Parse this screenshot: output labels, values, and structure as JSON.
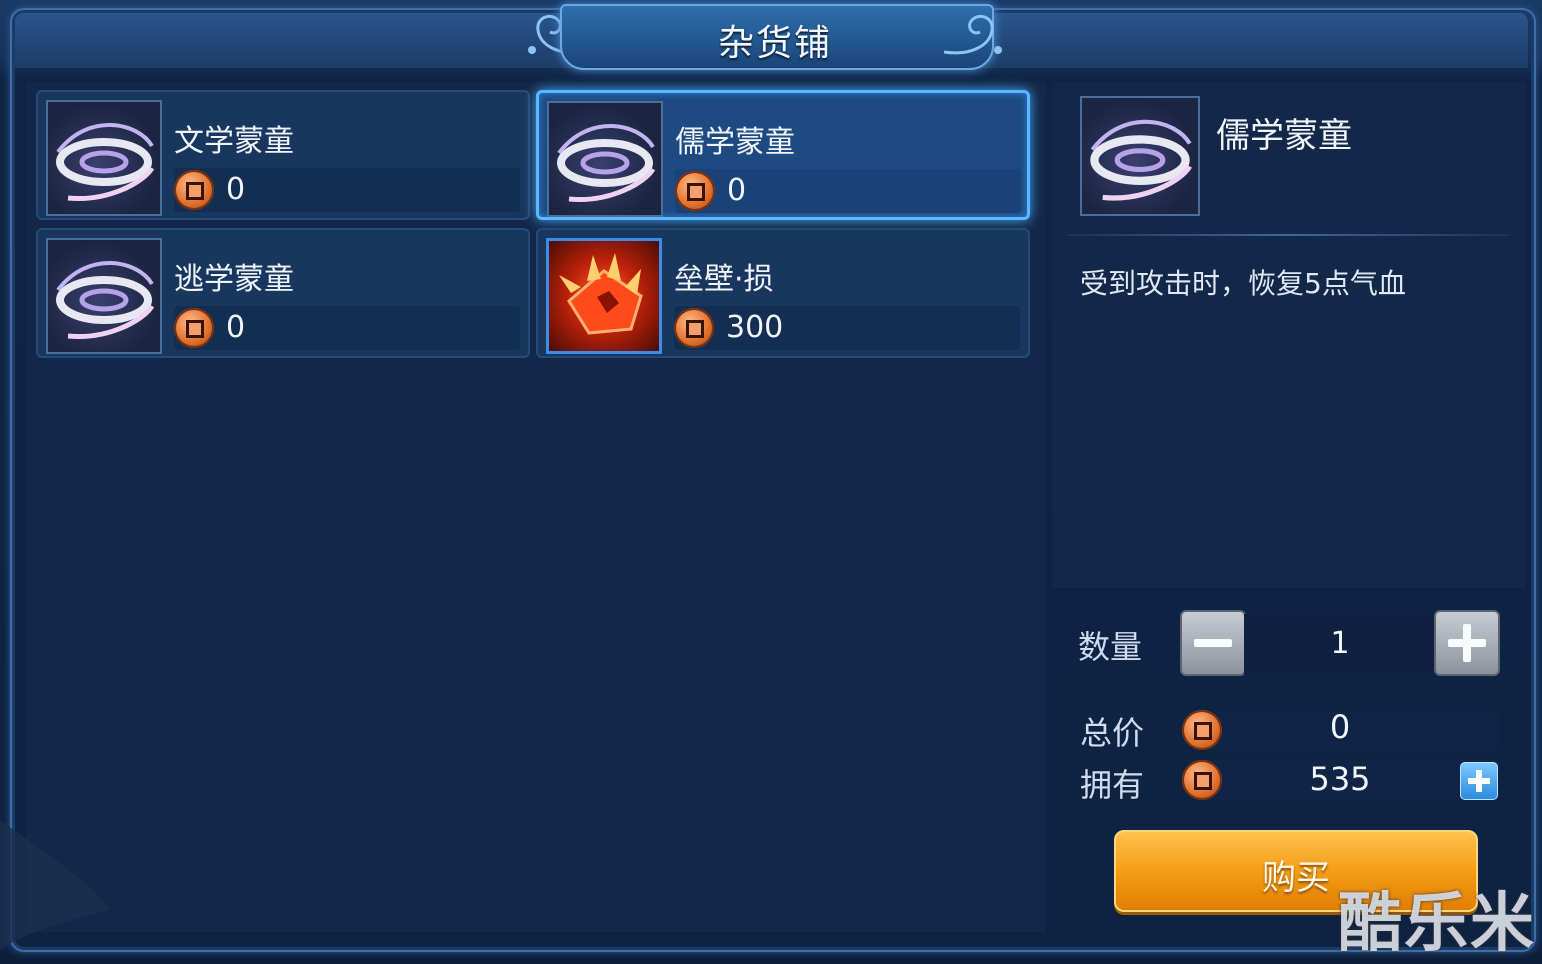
{
  "shop": {
    "title": "杂货铺"
  },
  "items": [
    {
      "name": "文学蒙童",
      "price": "0",
      "icon": "swirl-icon"
    },
    {
      "name": "儒学蒙童",
      "price": "0",
      "icon": "swirl-icon",
      "selected": true
    },
    {
      "name": "逃学蒙童",
      "price": "0",
      "icon": "swirl-icon"
    },
    {
      "name": "垒壁·损",
      "price": "300",
      "icon": "red-crystal-icon"
    }
  ],
  "detail": {
    "name": "儒学蒙童",
    "description": "受到攻击时，恢复5点气血",
    "quantity_label": "数量",
    "quantity": "1",
    "total_label": "总价",
    "total": "0",
    "owned_label": "拥有",
    "owned": "535",
    "buy_label": "购买"
  },
  "watermark": "酷乐米",
  "colors": {
    "background": "#0d1e38",
    "selected_border": "#59b8ff",
    "buy_button": "#f29a14",
    "coin": "#e0722e"
  }
}
